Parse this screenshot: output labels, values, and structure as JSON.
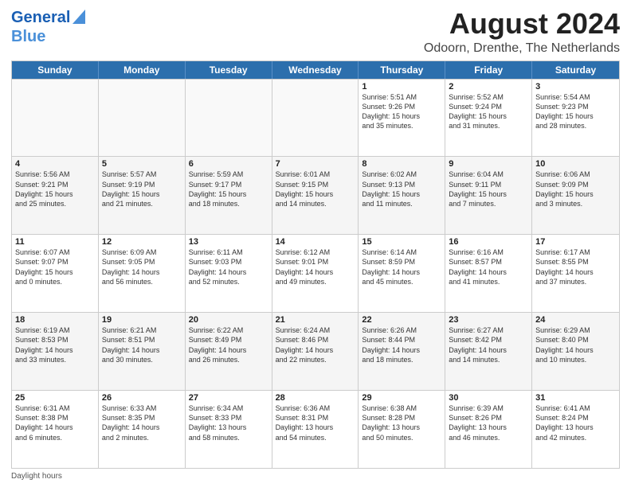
{
  "logo": {
    "line1": "General",
    "line2": "Blue"
  },
  "title": {
    "month_year": "August 2024",
    "location": "Odoorn, Drenthe, The Netherlands"
  },
  "header_days": [
    "Sunday",
    "Monday",
    "Tuesday",
    "Wednesday",
    "Thursday",
    "Friday",
    "Saturday"
  ],
  "weeks": [
    [
      {
        "day": "",
        "info": "",
        "empty": true
      },
      {
        "day": "",
        "info": "",
        "empty": true
      },
      {
        "day": "",
        "info": "",
        "empty": true
      },
      {
        "day": "",
        "info": "",
        "empty": true
      },
      {
        "day": "1",
        "info": "Sunrise: 5:51 AM\nSunset: 9:26 PM\nDaylight: 15 hours\nand 35 minutes.",
        "empty": false
      },
      {
        "day": "2",
        "info": "Sunrise: 5:52 AM\nSunset: 9:24 PM\nDaylight: 15 hours\nand 31 minutes.",
        "empty": false
      },
      {
        "day": "3",
        "info": "Sunrise: 5:54 AM\nSunset: 9:23 PM\nDaylight: 15 hours\nand 28 minutes.",
        "empty": false
      }
    ],
    [
      {
        "day": "4",
        "info": "Sunrise: 5:56 AM\nSunset: 9:21 PM\nDaylight: 15 hours\nand 25 minutes.",
        "empty": false
      },
      {
        "day": "5",
        "info": "Sunrise: 5:57 AM\nSunset: 9:19 PM\nDaylight: 15 hours\nand 21 minutes.",
        "empty": false
      },
      {
        "day": "6",
        "info": "Sunrise: 5:59 AM\nSunset: 9:17 PM\nDaylight: 15 hours\nand 18 minutes.",
        "empty": false
      },
      {
        "day": "7",
        "info": "Sunrise: 6:01 AM\nSunset: 9:15 PM\nDaylight: 15 hours\nand 14 minutes.",
        "empty": false
      },
      {
        "day": "8",
        "info": "Sunrise: 6:02 AM\nSunset: 9:13 PM\nDaylight: 15 hours\nand 11 minutes.",
        "empty": false
      },
      {
        "day": "9",
        "info": "Sunrise: 6:04 AM\nSunset: 9:11 PM\nDaylight: 15 hours\nand 7 minutes.",
        "empty": false
      },
      {
        "day": "10",
        "info": "Sunrise: 6:06 AM\nSunset: 9:09 PM\nDaylight: 15 hours\nand 3 minutes.",
        "empty": false
      }
    ],
    [
      {
        "day": "11",
        "info": "Sunrise: 6:07 AM\nSunset: 9:07 PM\nDaylight: 15 hours\nand 0 minutes.",
        "empty": false
      },
      {
        "day": "12",
        "info": "Sunrise: 6:09 AM\nSunset: 9:05 PM\nDaylight: 14 hours\nand 56 minutes.",
        "empty": false
      },
      {
        "day": "13",
        "info": "Sunrise: 6:11 AM\nSunset: 9:03 PM\nDaylight: 14 hours\nand 52 minutes.",
        "empty": false
      },
      {
        "day": "14",
        "info": "Sunrise: 6:12 AM\nSunset: 9:01 PM\nDaylight: 14 hours\nand 49 minutes.",
        "empty": false
      },
      {
        "day": "15",
        "info": "Sunrise: 6:14 AM\nSunset: 8:59 PM\nDaylight: 14 hours\nand 45 minutes.",
        "empty": false
      },
      {
        "day": "16",
        "info": "Sunrise: 6:16 AM\nSunset: 8:57 PM\nDaylight: 14 hours\nand 41 minutes.",
        "empty": false
      },
      {
        "day": "17",
        "info": "Sunrise: 6:17 AM\nSunset: 8:55 PM\nDaylight: 14 hours\nand 37 minutes.",
        "empty": false
      }
    ],
    [
      {
        "day": "18",
        "info": "Sunrise: 6:19 AM\nSunset: 8:53 PM\nDaylight: 14 hours\nand 33 minutes.",
        "empty": false
      },
      {
        "day": "19",
        "info": "Sunrise: 6:21 AM\nSunset: 8:51 PM\nDaylight: 14 hours\nand 30 minutes.",
        "empty": false
      },
      {
        "day": "20",
        "info": "Sunrise: 6:22 AM\nSunset: 8:49 PM\nDaylight: 14 hours\nand 26 minutes.",
        "empty": false
      },
      {
        "day": "21",
        "info": "Sunrise: 6:24 AM\nSunset: 8:46 PM\nDaylight: 14 hours\nand 22 minutes.",
        "empty": false
      },
      {
        "day": "22",
        "info": "Sunrise: 6:26 AM\nSunset: 8:44 PM\nDaylight: 14 hours\nand 18 minutes.",
        "empty": false
      },
      {
        "day": "23",
        "info": "Sunrise: 6:27 AM\nSunset: 8:42 PM\nDaylight: 14 hours\nand 14 minutes.",
        "empty": false
      },
      {
        "day": "24",
        "info": "Sunrise: 6:29 AM\nSunset: 8:40 PM\nDaylight: 14 hours\nand 10 minutes.",
        "empty": false
      }
    ],
    [
      {
        "day": "25",
        "info": "Sunrise: 6:31 AM\nSunset: 8:38 PM\nDaylight: 14 hours\nand 6 minutes.",
        "empty": false
      },
      {
        "day": "26",
        "info": "Sunrise: 6:33 AM\nSunset: 8:35 PM\nDaylight: 14 hours\nand 2 minutes.",
        "empty": false
      },
      {
        "day": "27",
        "info": "Sunrise: 6:34 AM\nSunset: 8:33 PM\nDaylight: 13 hours\nand 58 minutes.",
        "empty": false
      },
      {
        "day": "28",
        "info": "Sunrise: 6:36 AM\nSunset: 8:31 PM\nDaylight: 13 hours\nand 54 minutes.",
        "empty": false
      },
      {
        "day": "29",
        "info": "Sunrise: 6:38 AM\nSunset: 8:28 PM\nDaylight: 13 hours\nand 50 minutes.",
        "empty": false
      },
      {
        "day": "30",
        "info": "Sunrise: 6:39 AM\nSunset: 8:26 PM\nDaylight: 13 hours\nand 46 minutes.",
        "empty": false
      },
      {
        "day": "31",
        "info": "Sunrise: 6:41 AM\nSunset: 8:24 PM\nDaylight: 13 hours\nand 42 minutes.",
        "empty": false
      }
    ]
  ],
  "footer": {
    "daylight_label": "Daylight hours"
  }
}
